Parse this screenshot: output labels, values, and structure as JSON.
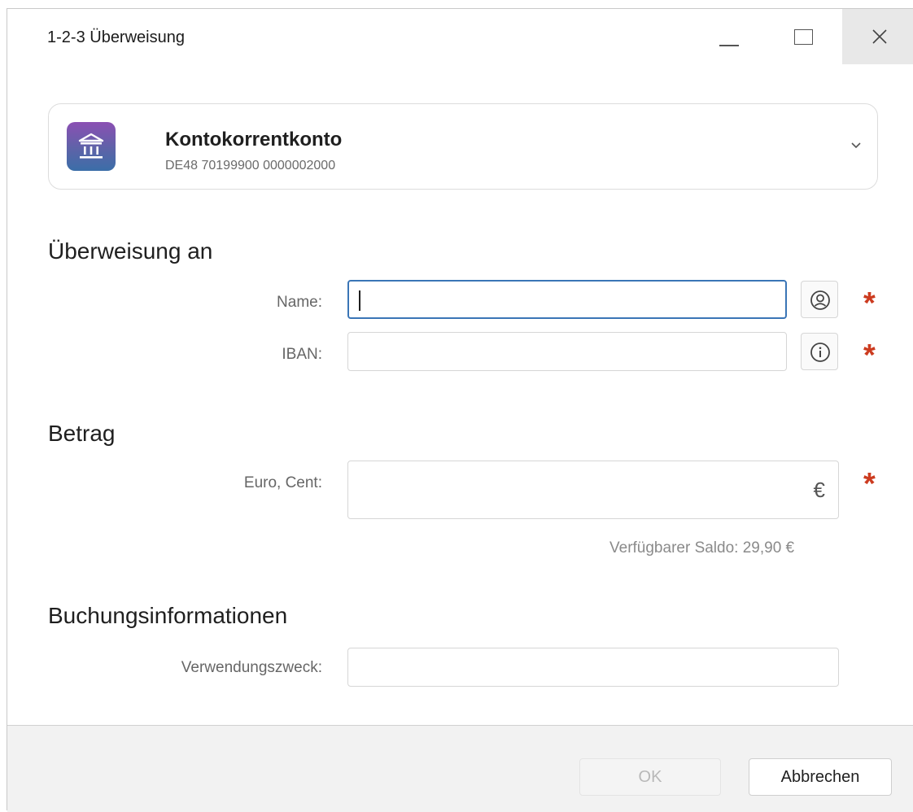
{
  "window": {
    "title": "1-2-3 Überweisung"
  },
  "account": {
    "name": "Kontokorrentkonto",
    "iban": "DE48 70199900 0000002000",
    "icon": "bank-icon"
  },
  "sections": {
    "recipient": "Überweisung an",
    "amount": "Betrag",
    "booking": "Buchungsinformationen"
  },
  "fields": {
    "name": {
      "label": "Name:",
      "value": "",
      "required_mark": "*"
    },
    "iban": {
      "label": "IBAN:",
      "value": "",
      "required_mark": "*"
    },
    "amount": {
      "label": "Euro, Cent:",
      "value": "",
      "currency": "€",
      "required_mark": "*"
    },
    "purpose": {
      "label": "Verwendungszweck:",
      "value": ""
    }
  },
  "balance": {
    "text": "Verfügbarer Saldo: 29,90 €"
  },
  "buttons": {
    "ok": "OK",
    "cancel": "Abbrechen"
  },
  "colors": {
    "required": "#cc3b1f",
    "focus": "#3a75b6"
  }
}
